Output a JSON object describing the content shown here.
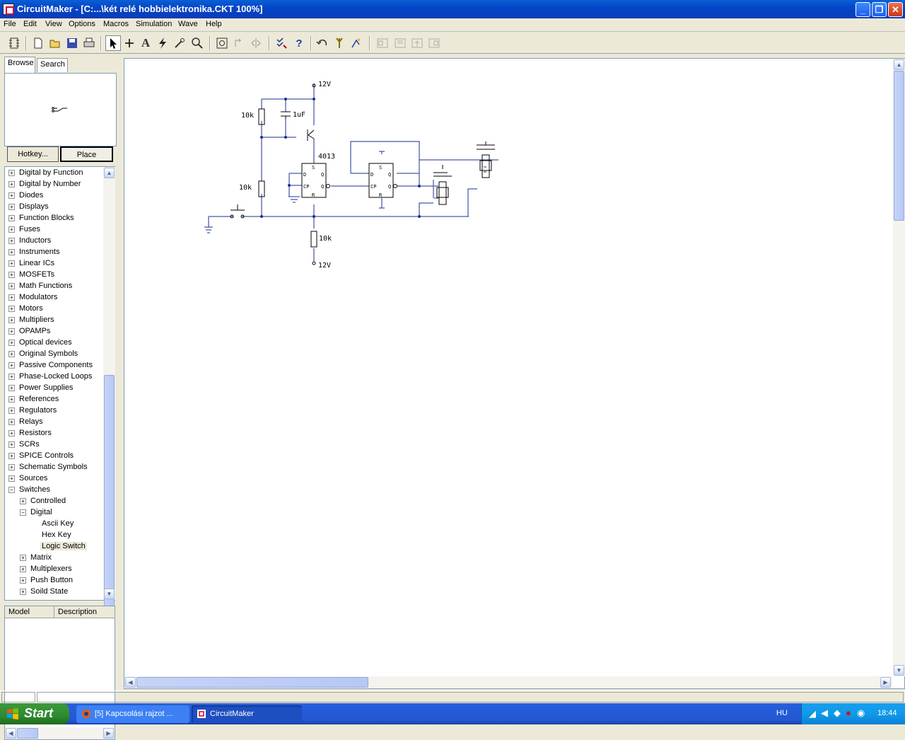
{
  "window": {
    "title": "CircuitMaker - [C:...\\két relé hobbielektronika.CKT 100%]",
    "buttons": [
      "minimize-icon",
      "restore-icon",
      "close-icon"
    ]
  },
  "menu": [
    "File",
    "Edit",
    "View",
    "Options",
    "Macros",
    "Simulation",
    "Wave",
    "Help"
  ],
  "toolbar": {
    "icons": [
      "component-icon",
      "new-icon",
      "open-icon",
      "save-icon",
      "print-icon",
      "arrow-icon",
      "wire-icon",
      "text-icon",
      "probe-icon",
      "wand-icon",
      "zoom-icon",
      "zoom-fit-icon",
      "rotate-icon",
      "mirror-icon",
      "netlist-icon",
      "help-icon",
      "undo-icon",
      "run-icon",
      "step-icon",
      "align-icons"
    ]
  },
  "browser": {
    "tabs": [
      "Browse",
      "Search"
    ],
    "active_tab": "Browse",
    "hotkey_label": "Hotkey...",
    "place_label": "Place",
    "tree": [
      {
        "label": "Digital by Function",
        "level": 0,
        "expanded": false
      },
      {
        "label": "Digital by Number",
        "level": 0,
        "expanded": false
      },
      {
        "label": "Diodes",
        "level": 0,
        "expanded": false
      },
      {
        "label": "Displays",
        "level": 0,
        "expanded": false
      },
      {
        "label": "Function Blocks",
        "level": 0,
        "expanded": false
      },
      {
        "label": "Fuses",
        "level": 0,
        "expanded": false
      },
      {
        "label": "Inductors",
        "level": 0,
        "expanded": false
      },
      {
        "label": "Instruments",
        "level": 0,
        "expanded": false
      },
      {
        "label": "Linear ICs",
        "level": 0,
        "expanded": false
      },
      {
        "label": "MOSFETs",
        "level": 0,
        "expanded": false
      },
      {
        "label": "Math Functions",
        "level": 0,
        "expanded": false
      },
      {
        "label": "Modulators",
        "level": 0,
        "expanded": false
      },
      {
        "label": "Motors",
        "level": 0,
        "expanded": false
      },
      {
        "label": "Multipliers",
        "level": 0,
        "expanded": false
      },
      {
        "label": "OPAMPs",
        "level": 0,
        "expanded": false
      },
      {
        "label": "Optical devices",
        "level": 0,
        "expanded": false
      },
      {
        "label": "Original Symbols",
        "level": 0,
        "expanded": false
      },
      {
        "label": "Passive Components",
        "level": 0,
        "expanded": false
      },
      {
        "label": "Phase-Locked Loops",
        "level": 0,
        "expanded": false
      },
      {
        "label": "Power Supplies",
        "level": 0,
        "expanded": false
      },
      {
        "label": "References",
        "level": 0,
        "expanded": false
      },
      {
        "label": "Regulators",
        "level": 0,
        "expanded": false
      },
      {
        "label": "Relays",
        "level": 0,
        "expanded": false
      },
      {
        "label": "Resistors",
        "level": 0,
        "expanded": false
      },
      {
        "label": "SCRs",
        "level": 0,
        "expanded": false
      },
      {
        "label": "SPICE Controls",
        "level": 0,
        "expanded": false
      },
      {
        "label": "Schematic Symbols",
        "level": 0,
        "expanded": false
      },
      {
        "label": "Sources",
        "level": 0,
        "expanded": false
      },
      {
        "label": "Switches",
        "level": 0,
        "expanded": true
      },
      {
        "label": "Controlled",
        "level": 1,
        "expanded": false
      },
      {
        "label": "Digital",
        "level": 1,
        "expanded": true
      },
      {
        "label": "Ascii Key",
        "level": 2,
        "leaf": true
      },
      {
        "label": "Hex Key",
        "level": 2,
        "leaf": true
      },
      {
        "label": "Logic Switch",
        "level": 2,
        "leaf": true,
        "selected": true
      },
      {
        "label": "Matrix",
        "level": 1,
        "expanded": false
      },
      {
        "label": "Multiplexers",
        "level": 1,
        "expanded": false
      },
      {
        "label": "Push Button",
        "level": 1,
        "expanded": false
      },
      {
        "label": "Soild State",
        "level": 1,
        "expanded": false
      }
    ],
    "model_columns": [
      "Model",
      "Description"
    ]
  },
  "schematic": {
    "labels": {
      "vcc_top": "12V",
      "r1": "10k",
      "c1": "1uF",
      "ic": "4013",
      "r2": "10k",
      "r3": "10k",
      "vcc_bottom": "12V",
      "pin_s": "S",
      "pin_d": "D",
      "pin_q": "Q",
      "pin_cp": "CP",
      "pin_qbar": "Q",
      "pin_r": "R"
    },
    "wire_color": "#1a2f8f"
  },
  "taskbar": {
    "start_label": "Start",
    "tasks": [
      {
        "label": "[5] Kapcsolási rajzot ...",
        "active": false
      },
      {
        "label": "CircuitMaker",
        "active": true
      }
    ],
    "language": "HU",
    "clock": "18:44"
  }
}
